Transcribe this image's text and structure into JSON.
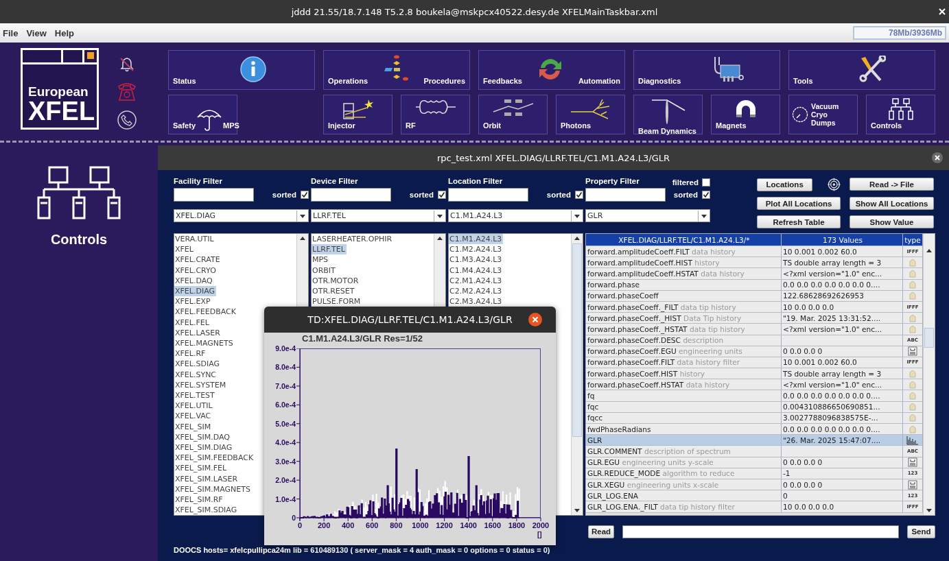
{
  "window": {
    "title": "jddd 21.55/18.7.148 T5.2.8  boukela@mskpcx40522.desy.de  XFELMainTaskbar.xml"
  },
  "menu": [
    {
      "label": "File"
    },
    {
      "label": "View"
    },
    {
      "label": "Help"
    }
  ],
  "memory": "78Mb/3936Mb",
  "logo": {
    "line_1": "European",
    "line_2": "XFEL"
  },
  "taskbar": {
    "row_1": [
      {
        "kind": "info",
        "labels": [
          "Status"
        ]
      },
      {
        "kind": "flowchart",
        "labels": [
          "Operations",
          "Procedures"
        ]
      },
      {
        "kind": "cycle",
        "labels": [
          "Feedbacks",
          "Automation"
        ]
      },
      {
        "kind": "diagnostics",
        "labels": [
          "Diagnostics"
        ]
      },
      {
        "kind": "tools",
        "labels": [
          "Tools"
        ]
      }
    ],
    "row_2": [
      {
        "kind": "umbrella",
        "labels": [
          "Safety",
          "MPS"
        ]
      },
      {
        "kind": "injector",
        "labels": [
          "Injector"
        ]
      },
      {
        "kind": "rf",
        "labels": [
          "RF"
        ]
      },
      {
        "kind": "orbit",
        "labels": [
          "Orbit"
        ]
      },
      {
        "kind": "photons",
        "labels": [
          "Photons"
        ]
      },
      {
        "kind": "beam",
        "labels": [
          "Beam Dynamics"
        ]
      },
      {
        "kind": "magnet",
        "labels": [
          "Magnets"
        ]
      },
      {
        "kind": "gauge",
        "labels": [
          "Vacuum",
          "Cryo",
          "Dumps"
        ]
      },
      {
        "kind": "network",
        "labels": [
          "Controls"
        ]
      }
    ]
  },
  "side_panel": {
    "label": "Controls"
  },
  "inner_window": {
    "title": "rpc_test.xml  XFEL.DIAG/LLRF.TEL/C1.M1.A24.L3/GLR"
  },
  "filters": [
    {
      "label": "Facility Filter",
      "sorted_label": "sorted",
      "sorted": true,
      "selection": "XFEL.DIAG",
      "items": [
        {
          "label": "VERA.UTIL",
          "selected": false
        },
        {
          "label": "XFEL",
          "selected": false
        },
        {
          "label": "XFEL.CRATE",
          "selected": false
        },
        {
          "label": "XFEL.CRYO",
          "selected": false
        },
        {
          "label": "XFEL.DAQ",
          "selected": false
        },
        {
          "label": "XFEL.DIAG",
          "selected": true
        },
        {
          "label": "XFEL.EXP",
          "selected": false
        },
        {
          "label": "XFEL.FEEDBACK",
          "selected": false
        },
        {
          "label": "XFEL.FEL",
          "selected": false
        },
        {
          "label": "XFEL.LASER",
          "selected": false
        },
        {
          "label": "XFEL.MAGNETS",
          "selected": false
        },
        {
          "label": "XFEL.RF",
          "selected": false
        },
        {
          "label": "XFEL.SDIAG",
          "selected": false
        },
        {
          "label": "XFEL.SYNC",
          "selected": false
        },
        {
          "label": "XFEL.SYSTEM",
          "selected": false
        },
        {
          "label": "XFEL.TEST",
          "selected": false
        },
        {
          "label": "XFEL.UTIL",
          "selected": false
        },
        {
          "label": "XFEL.VAC",
          "selected": false
        },
        {
          "label": "XFEL_SIM",
          "selected": false
        },
        {
          "label": "XFEL_SIM.DAQ",
          "selected": false
        },
        {
          "label": "XFEL_SIM.DIAG",
          "selected": false
        },
        {
          "label": "XFEL_SIM.FEEDBACK",
          "selected": false
        },
        {
          "label": "XFEL_SIM.FEL",
          "selected": false
        },
        {
          "label": "XFEL_SIM.LASER",
          "selected": false
        },
        {
          "label": "XFEL_SIM.MAGNETS",
          "selected": false
        },
        {
          "label": "XFEL_SIM.RF",
          "selected": false
        },
        {
          "label": "XFEL_SIM.SDIAG",
          "selected": false
        }
      ]
    },
    {
      "label": "Device Filter",
      "sorted_label": "sorted",
      "sorted": true,
      "selection": "LLRF.TEL",
      "items": [
        {
          "label": "LASERHEATER.OPHIR",
          "selected": false
        },
        {
          "label": "LLRF.TEL",
          "selected": true
        },
        {
          "label": "MPS",
          "selected": false
        },
        {
          "label": "ORBIT",
          "selected": false
        },
        {
          "label": "OTR.MOTOR",
          "selected": false
        },
        {
          "label": "OTR.RESET",
          "selected": false
        },
        {
          "label": "PULSE.FORM",
          "selected": false
        }
      ]
    },
    {
      "label": "Location Filter",
      "sorted_label": "sorted",
      "sorted": true,
      "selection": "C1.M1.A24.L3",
      "items": [
        {
          "label": "C1.M1.A24.L3",
          "selected": true
        },
        {
          "label": "C1.M2.A24.L3",
          "selected": false
        },
        {
          "label": "C1.M3.A24.L3",
          "selected": false
        },
        {
          "label": "C1.M4.A24.L3",
          "selected": false
        },
        {
          "label": "C2.M1.A24.L3",
          "selected": false
        },
        {
          "label": "C2.M2.A24.L3",
          "selected": false
        },
        {
          "label": "C2.M3.A24.L3",
          "selected": false
        }
      ]
    },
    {
      "label": "Property Filter",
      "sorted_label": "sorted",
      "sorted": true,
      "filtered_label": "filtered",
      "filtered": false,
      "selection": "GLR"
    }
  ],
  "buttons": [
    {
      "label": "Locations"
    },
    {
      "label": "Read -> File"
    },
    {
      "label": "Plot All Locations"
    },
    {
      "label": "Show All Locations"
    },
    {
      "label": "Refresh Table"
    },
    {
      "label": "Show Value"
    }
  ],
  "table": {
    "columns": [
      "XFEL.DIAG/LLRF.TEL/C1.M1.A24.L3/*",
      "173 Values",
      "type"
    ],
    "rows": [
      {
        "name": "forward.amplitudeCoeff.FILT",
        "description": "data history",
        "value": "10 0.001 0.002 60.0",
        "type": {
          "kind": "label",
          "text": "IFFF"
        },
        "selected": false
      },
      {
        "name": "forward.amplitudeCoeff.HIST",
        "description": "history",
        "value": "TS double array length = 3",
        "type": {
          "kind": "history"
        },
        "selected": false
      },
      {
        "name": "forward.amplitudeCoeff.HSTAT",
        "description": "data history",
        "value": "<?xml version=\"1.0\" enc...",
        "type": {
          "kind": "history"
        },
        "selected": false
      },
      {
        "name": "forward.phase",
        "value": "0.0 0.0 0.0 0.0 0.0 0.0 0....",
        "type": {
          "kind": "history"
        },
        "selected": false
      },
      {
        "name": "forward.phaseCoeff",
        "value": "122.68628692626953",
        "type": {
          "kind": "history"
        },
        "selected": false
      },
      {
        "name": "forward.phaseCoeff._FILT",
        "description": "data tip history",
        "value": "10 0.0 0.0 0.0",
        "type": {
          "kind": "label",
          "text": "IFFF"
        },
        "selected": false
      },
      {
        "name": "forward.phaseCoeff._HIST",
        "description": "Data Tip history",
        "value": "\"19. Mar. 2025 13:31:52....",
        "type": {
          "kind": "history"
        },
        "selected": false
      },
      {
        "name": "forward.phaseCoeff._HSTAT",
        "description": "data tip history",
        "value": "<?xml version=\"1.0\" enc...",
        "type": {
          "kind": "history"
        },
        "selected": false
      },
      {
        "name": "forward.phaseCoeff.DESC",
        "description": "description",
        "type": {
          "kind": "label",
          "text": "ABC"
        },
        "selected": false
      },
      {
        "name": "forward.phaseCoeff.EGU",
        "description": "engineering units",
        "value": "0 0.0 0.0 0",
        "type": {
          "kind": "string"
        },
        "selected": false
      },
      {
        "name": "forward.phaseCoeff.FILT",
        "description": "data history filter",
        "value": "10 0.001 0.002 60.0",
        "type": {
          "kind": "label",
          "text": "IFFF"
        },
        "selected": false
      },
      {
        "name": "forward.phaseCoeff.HIST",
        "description": "history",
        "value": "TS double array length = 3",
        "type": {
          "kind": "history"
        },
        "selected": false
      },
      {
        "name": "forward.phaseCoeff.HSTAT",
        "description": "data history",
        "value": "<?xml version=\"1.0\" enc...",
        "type": {
          "kind": "history"
        },
        "selected": false
      },
      {
        "name": "fq",
        "value": "0.0 0.0 0.0 0.0 0.0 0.0 0....",
        "type": {
          "kind": "history"
        },
        "selected": false
      },
      {
        "name": "fqc",
        "value": "0.004310886650690851...",
        "type": {
          "kind": "history"
        },
        "selected": false
      },
      {
        "name": "fqcc",
        "value": "3.0027788096838575E-...",
        "type": {
          "kind": "history"
        },
        "selected": false
      },
      {
        "name": "fwdPhaseRadians",
        "value": "0.0 0.0 0.0 0.0 0.0 0.0 0....",
        "type": {
          "kind": "history"
        },
        "selected": false
      },
      {
        "name": "GLR",
        "value": "\"26. Mar. 2025 15:47:07....",
        "type": {
          "kind": "spectrum"
        },
        "selected": true
      },
      {
        "name": "GLR.COMMENT",
        "description": "description of spectrum",
        "type": {
          "kind": "label",
          "text": "ABC"
        },
        "selected": false
      },
      {
        "name": "GLR.EGU",
        "description": "engineering units y-scale",
        "value": "0 0.0 0.0 0",
        "type": {
          "kind": "string"
        },
        "selected": false
      },
      {
        "name": "GLR.REDUCE_MODE",
        "description": "algorithm to reduce",
        "value": "-1",
        "type": {
          "kind": "label",
          "text": "123"
        },
        "selected": false
      },
      {
        "name": "GLR.XEGU",
        "description": "engineering units x-scale",
        "value": "0 0.0 0.0 0",
        "type": {
          "kind": "string"
        },
        "selected": false
      },
      {
        "name": "GLR_LOG.ENA",
        "value": "0",
        "type": {
          "kind": "label",
          "text": "123"
        },
        "selected": false
      },
      {
        "name": "GLR_LOG.ENA._FILT",
        "description": "data tip history filter",
        "value": "10 0.0 0.0 0.0",
        "type": {
          "kind": "label",
          "text": "IFFF"
        },
        "selected": false
      }
    ]
  },
  "command": {
    "read_label": "Read",
    "send_label": "Send"
  },
  "status": "DOOCS hosts= xfelcpullipca24m lib = 610489130 ( server_mask = 4 auth_mask = 0 options = 0 status = 0)",
  "popup": {
    "title": "TD:XFEL.DIAG/LLRF.TEL/C1.M1.A24.L3/GLR",
    "plot_title": "C1.M1.A24.L3/GLR Res=1/52",
    "y_ticks": [
      "9.0e-4",
      "8.0e-4",
      "7.0e-4",
      "6.0e-4",
      "5.0e-4",
      "4.0e-4",
      "3.0e-4",
      "2.0e-4",
      "1.0e-4",
      "0"
    ],
    "x_ticks": [
      "0",
      "200",
      "400",
      "600",
      "800",
      "1000",
      "1200",
      "1400",
      "1600",
      "1800",
      "2000"
    ],
    "x_unit": "[]"
  }
}
